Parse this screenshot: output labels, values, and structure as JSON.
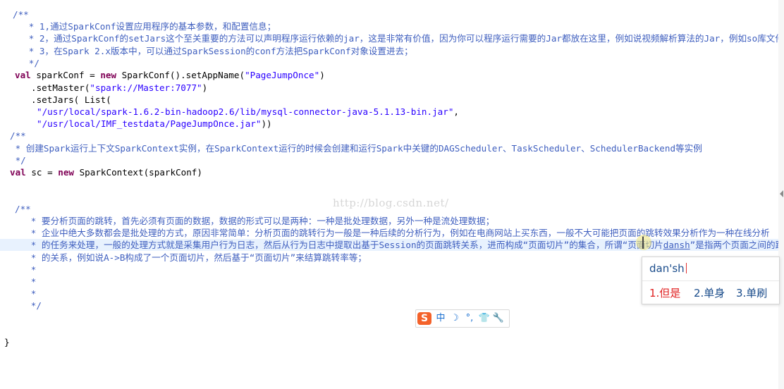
{
  "editor": {
    "lines": {
      "l1": "/**",
      "l2": "   * 1,通过SparkConf设置应用程序的基本参数，和配置信息；",
      "l3": "   * 2，通过SparkConf的setJars这个至关重要的方法可以声明程序运行依赖的jar，这是非常有价值，因为你可以程序运行需要的Jar都放在这里，例如说视频解析算法的Jar，例如so库文件等；",
      "l4": "   * 3，在Spark 2.x版本中，可以通过SparkSession的conf方法把SparkConf对象设置进去；",
      "l5": "   */",
      "l6_kw": "val",
      "l6_a": " sparkConf = ",
      "l6_kw2": "new",
      "l6_b": " SparkConf().setAppName(",
      "l6_str": "\"PageJumpOnce\"",
      "l6_c": ")",
      "l7_a": ".setMaster(",
      "l7_str": "\"spark://Master:7077\"",
      "l7_c": ")",
      "l8": ".setJars( List(",
      "l9_str": "\"/usr/local/spark-1.6.2-bin-hadoop2.6/lib/mysql-connector-java-5.1.13-bin.jar\"",
      "l9_c": ",",
      "l10_str": "\"/usr/local/IMF_testdata/PageJumpOnce.jar\"",
      "l10_c": "))",
      "l11": "/**",
      "l12": " * 创建Spark运行上下文SparkContext实例，在SparkContext运行的时候会创建和运行Spark中关键的DAGScheduler、TaskScheduler、SchedulerBackend等实例",
      "l13": " */",
      "l14_kw": "val",
      "l14_a": " sc = ",
      "l14_kw2": "new",
      "l14_b": " SparkContext(sparkConf)",
      "l15": "/**",
      "l16": "   * 要分析页面的跳转，首先必须有页面的数据，数据的形式可以是两种：一种是批处理数据，另外一种是流处理数据；",
      "l17": "   * 企业中绝大多数都会是批处理的方式，原因非常简单：分析页面的跳转行为一般是一种后续的分析行为，例如在电商网站上买东西，一般不大可能把页面的跳转效果分析作为一种在线分析",
      "l18_a": "   * 的任务来处理，一般的处理方式就是采集用户行为日志，然后从行为日志中提取出基于Session的页面跳转关系，进而构成“页面切片”的集合，所谓“页面切片",
      "l18_pinyin": "dansh",
      "l18_b": "”是指两个页面之间的跳转构",
      "l19": "   * 的关系，例如说A->B构成了一个页面切片，然后基于“页面切片”来结算跳转率等；",
      "l20": "   *",
      "l21": "   *",
      "l22": "   *",
      "l23": "   */",
      "l24": "}"
    }
  },
  "watermark": "http://blog.csdn.net/",
  "ime": {
    "pinyin": "dan'sh",
    "candidates": [
      "1.但是",
      "2.单身",
      "3.单刷"
    ]
  },
  "ime_toolbar": {
    "logo": "S",
    "mode": "中",
    "moon": "☽",
    "punct": "°,",
    "skin": "👕",
    "tools": "🔧"
  }
}
